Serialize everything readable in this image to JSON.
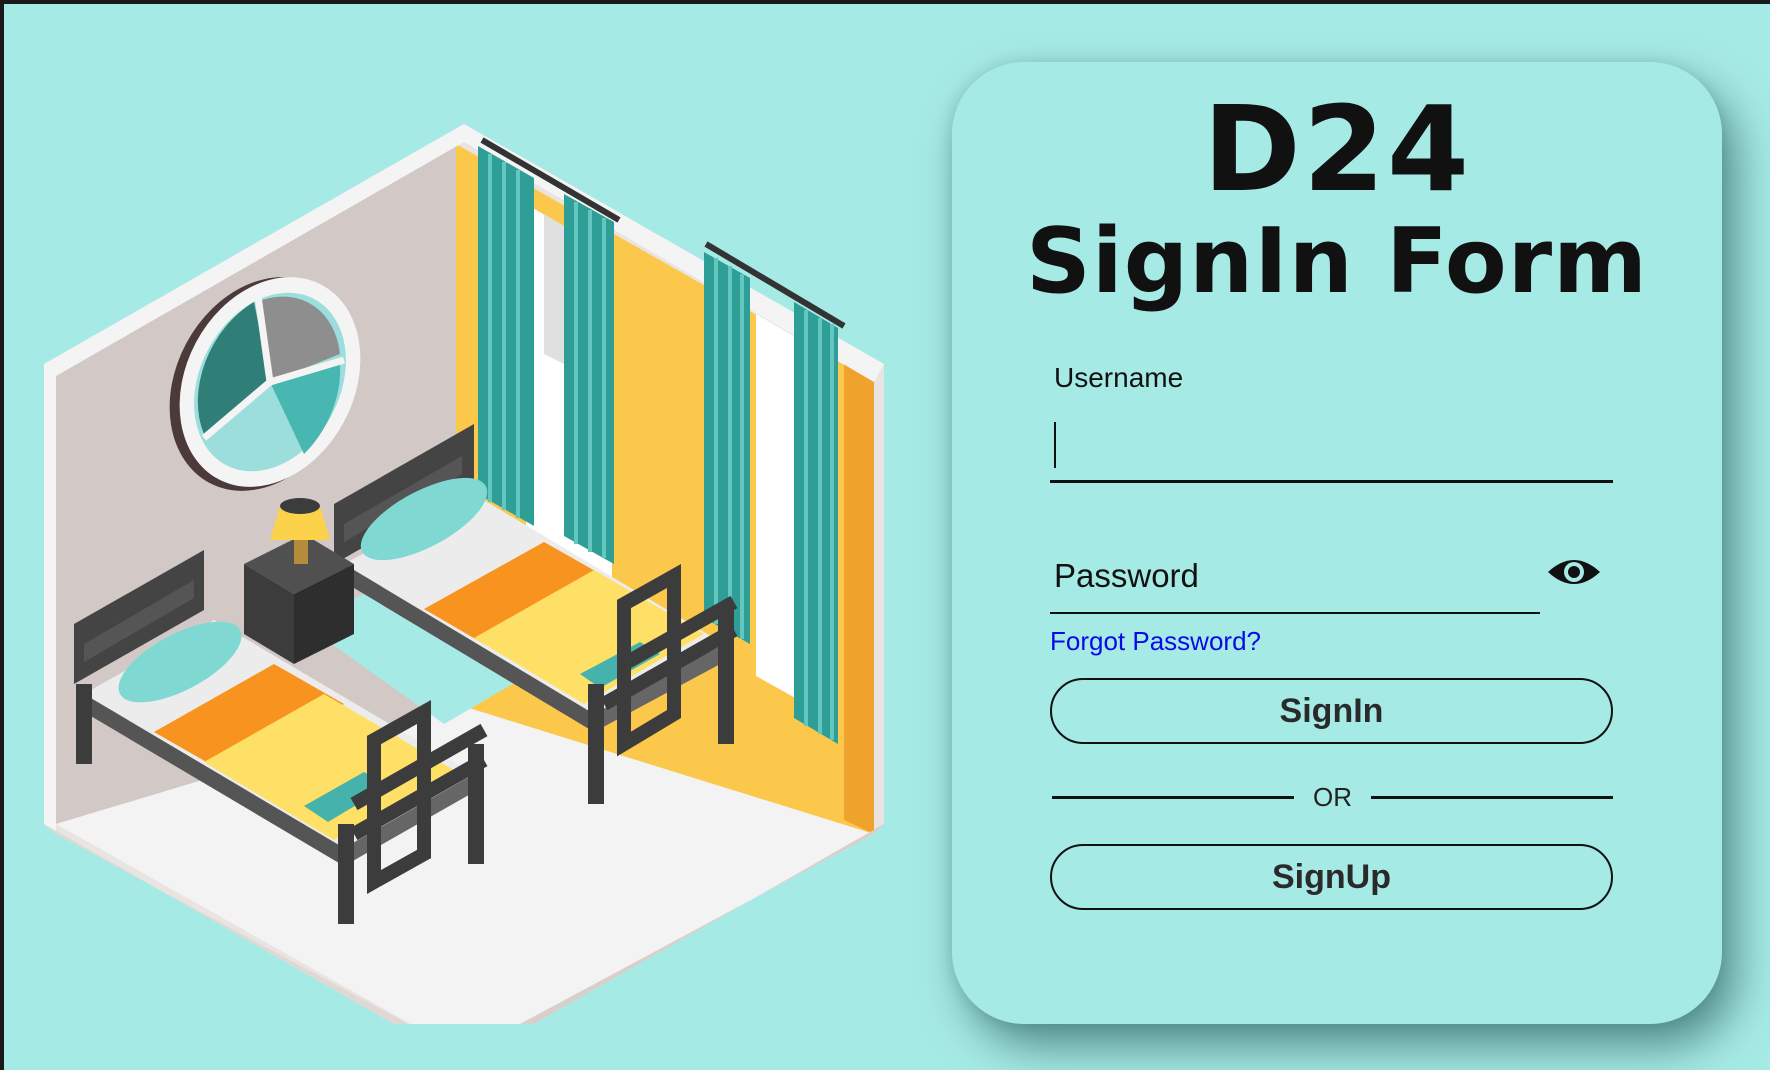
{
  "brand": "D24",
  "form_title": "SignIn Form",
  "username": {
    "label": "Username",
    "value": ""
  },
  "password": {
    "placeholder": "Password",
    "value": "",
    "toggle_icon": "eye-icon"
  },
  "forgot_password_link": "Forgot Password?",
  "signin_button": "SignIn",
  "divider_text": "OR",
  "signup_button": "SignUp",
  "colors": {
    "background": "#a6eae6",
    "link": "#0a0ae6",
    "text": "#111111"
  }
}
